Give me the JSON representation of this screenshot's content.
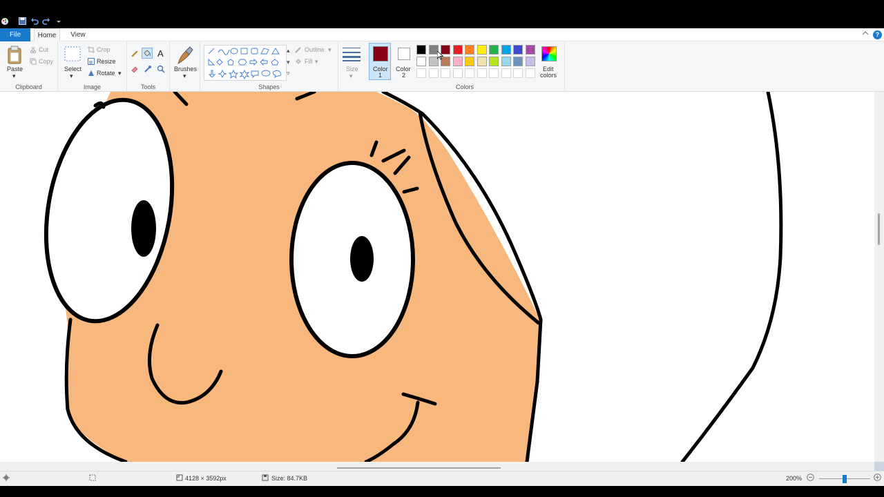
{
  "quick_access": {
    "icons": [
      "paint-app-icon",
      "save-icon",
      "undo-icon",
      "redo-icon",
      "customize-quick-access-icon"
    ]
  },
  "tabs": {
    "file": "File",
    "home": "Home",
    "view": "View"
  },
  "ribbon": {
    "clipboard": {
      "paste": "Paste",
      "cut": "Cut",
      "copy": "Copy",
      "group": "Clipboard"
    },
    "image": {
      "select": "Select",
      "crop": "Crop",
      "resize": "Resize",
      "rotate": "Rotate",
      "group": "Image"
    },
    "tools": {
      "group": "Tools",
      "text_tool": "A"
    },
    "brushes": {
      "label": "Brushes"
    },
    "shapes": {
      "outline": "Outline",
      "fill": "Fill",
      "group": "Shapes"
    },
    "size": {
      "label": "Size"
    },
    "colors": {
      "color1_line1": "Color",
      "color1_line2": "1",
      "color2_line1": "Color",
      "color2_line2": "2",
      "edit_line1": "Edit",
      "edit_line2": "colors",
      "group": "Colors",
      "color1_value": "#880015",
      "color2_value": "#ffffff",
      "palette_row1": [
        "#000000",
        "#7f7f7f",
        "#880015",
        "#ed1c24",
        "#ff7f27",
        "#fff200",
        "#22b14c",
        "#00a2e8",
        "#3f48cc",
        "#a349a4"
      ],
      "palette_row2": [
        "#ffffff",
        "#c3c3c3",
        "#b97a57",
        "#ffaec9",
        "#ffc90e",
        "#efe4b0",
        "#b5e61d",
        "#99d9ea",
        "#7092be",
        "#c8bfe7"
      ]
    }
  },
  "canvas": {
    "skin_color": "#f8b77d",
    "outline_color": "#000000"
  },
  "status": {
    "dimensions": "4128 × 3592px",
    "size": "Size: 84.7KB",
    "zoom": "200%",
    "zoom_level_fraction": 0.5
  }
}
